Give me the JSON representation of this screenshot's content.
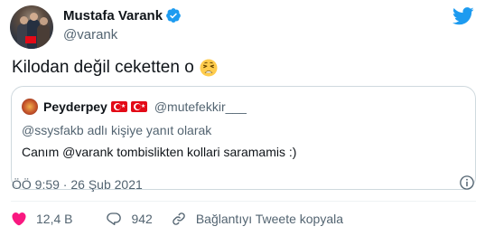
{
  "author": {
    "name": "Mustafa Varank",
    "handle": "@varank"
  },
  "tweet": {
    "text": "Kilodan değil ceketten o"
  },
  "quoted": {
    "name": "Peyderpey",
    "handle": "@mutefekkir___",
    "reply_context": "@ssysfakb adlı kişiye yanıt olarak",
    "text": "Canım @varank tombislikten kollari saramamis :)"
  },
  "meta": {
    "timestamp": "ÖÖ 9:59 · 26 Şub 2021"
  },
  "actions": {
    "likes": "12,4 B",
    "replies": "942",
    "copy_link": "Bağlantıyı Tweete kopyala"
  },
  "colors": {
    "brand": "#1d9bf0",
    "like": "#f91880",
    "text": "#0f1419",
    "muted": "#536471",
    "border": "#cfd9de"
  },
  "icons": [
    "twitter-logo-icon",
    "verified-badge-icon",
    "weary-face-emoji-icon",
    "turkey-flag-icon",
    "info-icon",
    "heart-icon",
    "reply-icon",
    "link-icon"
  ]
}
